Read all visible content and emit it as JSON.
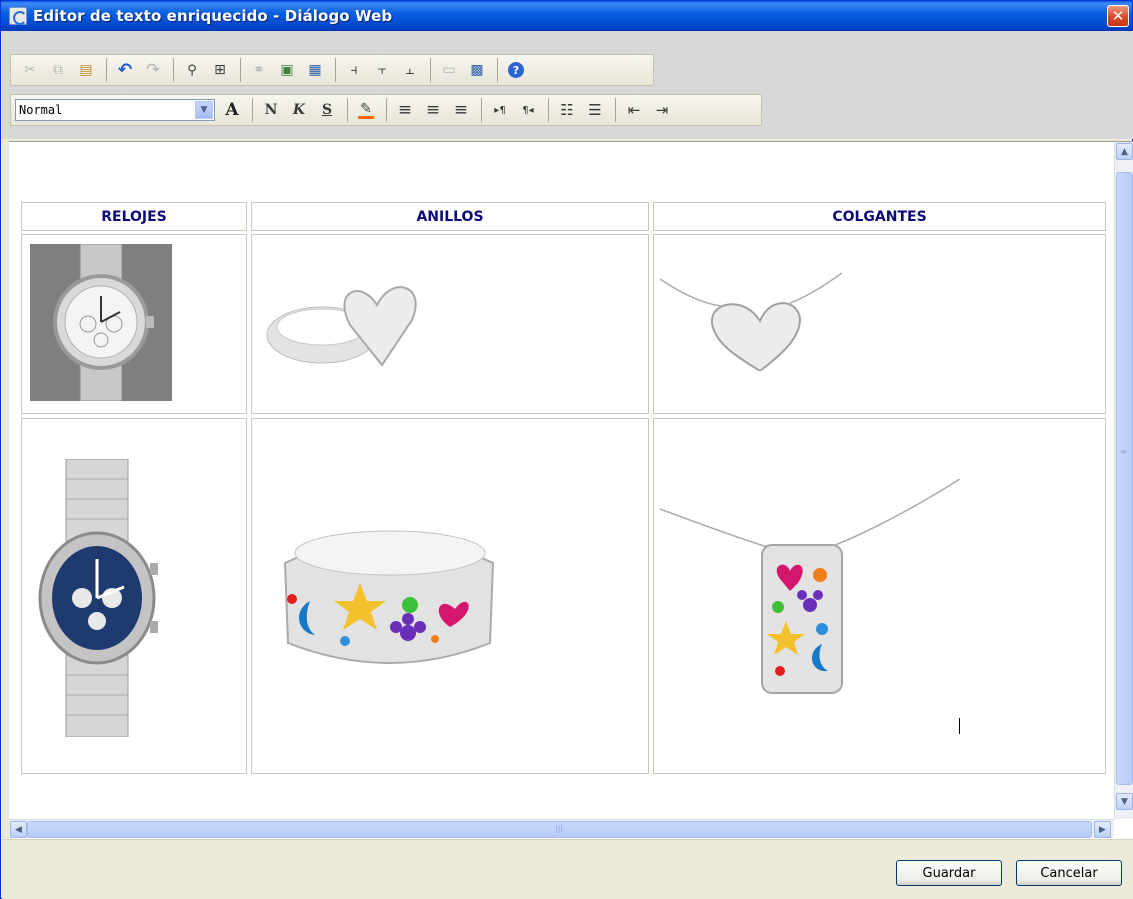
{
  "window": {
    "title": "Editor de texto enriquecido - Diálogo Web",
    "close_glyph": "✕"
  },
  "toolbar1": {
    "buttons": [
      {
        "icon": "cut-icon",
        "glyph": "✂",
        "enabled": false
      },
      {
        "icon": "copy-icon",
        "glyph": "⧉",
        "enabled": false
      },
      {
        "icon": "paste-icon",
        "glyph": "📋",
        "enabled": true
      },
      {
        "icon": "undo-icon",
        "glyph": "↶",
        "enabled": true
      },
      {
        "icon": "redo-icon",
        "glyph": "↷",
        "enabled": false
      },
      {
        "icon": "find-icon",
        "glyph": "🔍",
        "enabled": true
      },
      {
        "icon": "select-all-icon",
        "glyph": "⊞",
        "enabled": true
      },
      {
        "icon": "link-icon",
        "glyph": "🔗",
        "enabled": false
      },
      {
        "icon": "image-icon",
        "glyph": "🖼",
        "enabled": true
      },
      {
        "icon": "insert-table-icon",
        "glyph": "▦",
        "enabled": true
      },
      {
        "icon": "insert-column-icon",
        "glyph": "⫞",
        "enabled": true
      },
      {
        "icon": "insert-row-icon",
        "glyph": "⫟",
        "enabled": true
      },
      {
        "icon": "delete-column-icon",
        "glyph": "⫠",
        "enabled": true
      },
      {
        "icon": "table-border-icon",
        "glyph": "▭",
        "enabled": false
      },
      {
        "icon": "table-props-icon",
        "glyph": "▩",
        "enabled": true
      },
      {
        "icon": "help-icon",
        "glyph": "?",
        "enabled": true
      }
    ]
  },
  "toolbar2": {
    "style_select": {
      "value": "Normal",
      "arrow": "▼"
    },
    "font_color_glyph": "A",
    "bold": "N",
    "italic": "K",
    "strike": "S",
    "highlight_glyph": "✎",
    "align_left_glyph": "≡",
    "align_center_glyph": "≡",
    "align_right_glyph": "≡",
    "ltr_glyph": "▸¶",
    "rtl_glyph": "¶◂",
    "ordered_list_glyph": "☷",
    "unordered_list_glyph": "☰",
    "outdent_glyph": "⇤",
    "indent_glyph": "⇥"
  },
  "table": {
    "headers": [
      "RELOJES",
      "ANILLOS",
      "COLGANTES"
    ]
  },
  "scroll": {
    "up": "▲",
    "down": "▼",
    "left": "◀",
    "right": "▶",
    "grip": "|||"
  },
  "footer": {
    "save_label": "Guardar",
    "cancel_label": "Cancelar"
  },
  "colors": {
    "titlebar": "#0a5fe0",
    "header_text": "#0b0b7a",
    "highlight_accent": "#ff6a00"
  }
}
